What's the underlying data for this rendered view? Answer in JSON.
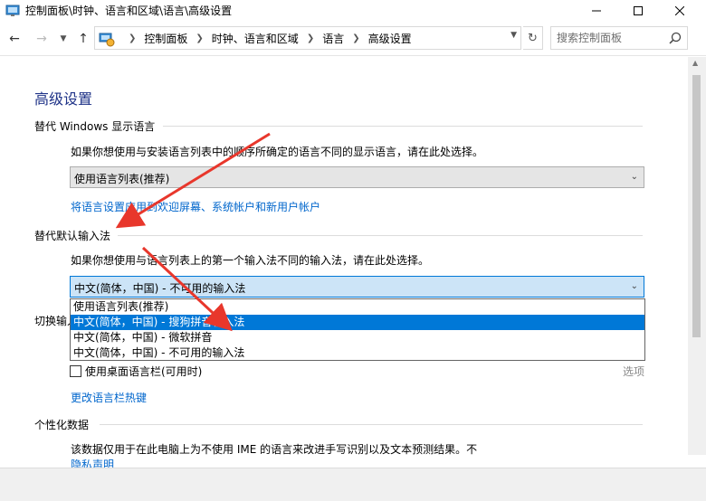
{
  "window": {
    "title": "控制面板\\时钟、语言和区域\\语言\\高级设置"
  },
  "nav": {
    "breadcrumbs": [
      "控制面板",
      "时钟、语言和区域",
      "语言",
      "高级设置"
    ]
  },
  "search": {
    "placeholder": "搜索控制面板"
  },
  "content": {
    "page_title": "高级设置",
    "display_lang": {
      "title": "替代 Windows 显示语言",
      "description": "如果你想使用与安装语言列表中的顺序所确定的语言不同的显示语言，请在此处选择。",
      "selected": "使用语言列表(推荐)",
      "apply_link": "将语言设置应用到欢迎屏幕、系统帐户和新用户帐户"
    },
    "input_method": {
      "title": "替代默认输入法",
      "description": "如果你想使用与语言列表上的第一个输入法不同的输入法，请在此处选择。",
      "selected": "中文(简体，中国) - 不可用的输入法",
      "options": [
        "使用语言列表(推荐)",
        "中文(简体，中国) - 搜狗拼音输入法",
        "中文(简体，中国) - 微软拼音",
        "中文(简体，中国) - 不可用的输入法"
      ],
      "highlighted_index": 1
    },
    "switch_input": {
      "title_partial": "切换输入",
      "desktop_langbar_label": "使用桌面语言栏(可用时)",
      "options_link": "选项",
      "hotkeys_link": "更改语言栏热键"
    },
    "personalization": {
      "title": "个性化数据",
      "description": "该数据仅用于在此电脑上为不使用 IME 的语言来改进手写识别以及文本预测结果。不",
      "privacy_link": "隐私声明"
    }
  },
  "colors": {
    "page_title": "#1e3287",
    "link": "#0066cc",
    "selection": "#0078d7",
    "annotation_arrow": "#e8372c"
  }
}
